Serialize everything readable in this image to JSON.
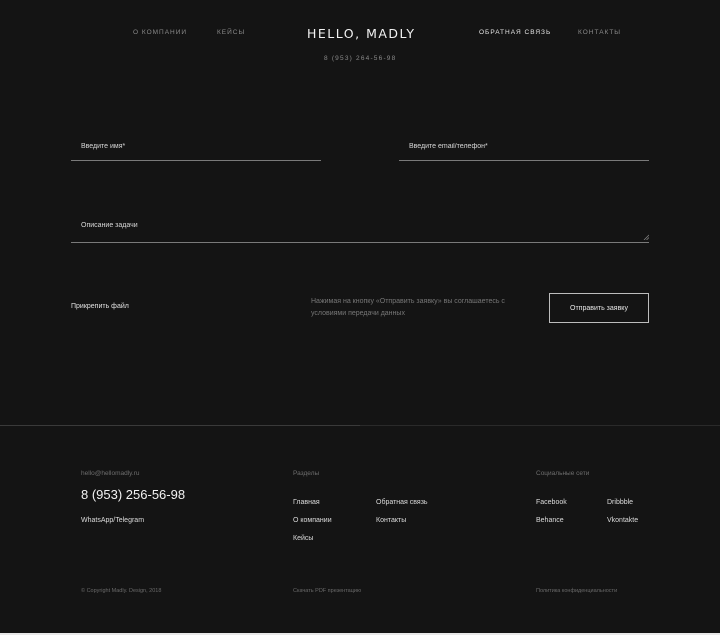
{
  "header": {
    "nav_left": [
      "О компании",
      "Кейсы"
    ],
    "logo": "HELLO, MADLY",
    "phone": "8 (953) 264-56-98",
    "nav_right": [
      "Обратная связь",
      "Контакты"
    ]
  },
  "form": {
    "name_placeholder": "Введите имя*",
    "contact_placeholder": "Введите email/телефон*",
    "task_placeholder": "Описание задачи",
    "attach_label": "Прикрепить файл",
    "consent_text": "Нажимая на кнопку «Отправить заявку» вы соглашаетесь с условиями передачи данных",
    "submit_label": "Отправить заявку"
  },
  "footer": {
    "email": "hello@hellomadly.ru",
    "phone": "8 (953) 256-56-98",
    "messengers": "WhatsApp/Telegram",
    "sections_heading": "Разделы",
    "sections_col1": [
      "Главная",
      "О компании",
      "Кейсы"
    ],
    "sections_col2": [
      "Обратная связь",
      "Контакты"
    ],
    "social_heading": "Социальные сети",
    "social_col1": [
      "Facebook",
      "Behance"
    ],
    "social_col2": [
      "Dribbble",
      "Vkontakte"
    ],
    "copyright": "© Copyright Madly. Design, 2018",
    "pdf_link": "Скачать PDF презентацию",
    "privacy_link": "Политика конфиденциальности"
  },
  "colors": {
    "background": "#141414",
    "text": "#e8e8e8",
    "muted": "#6e6e6e"
  }
}
